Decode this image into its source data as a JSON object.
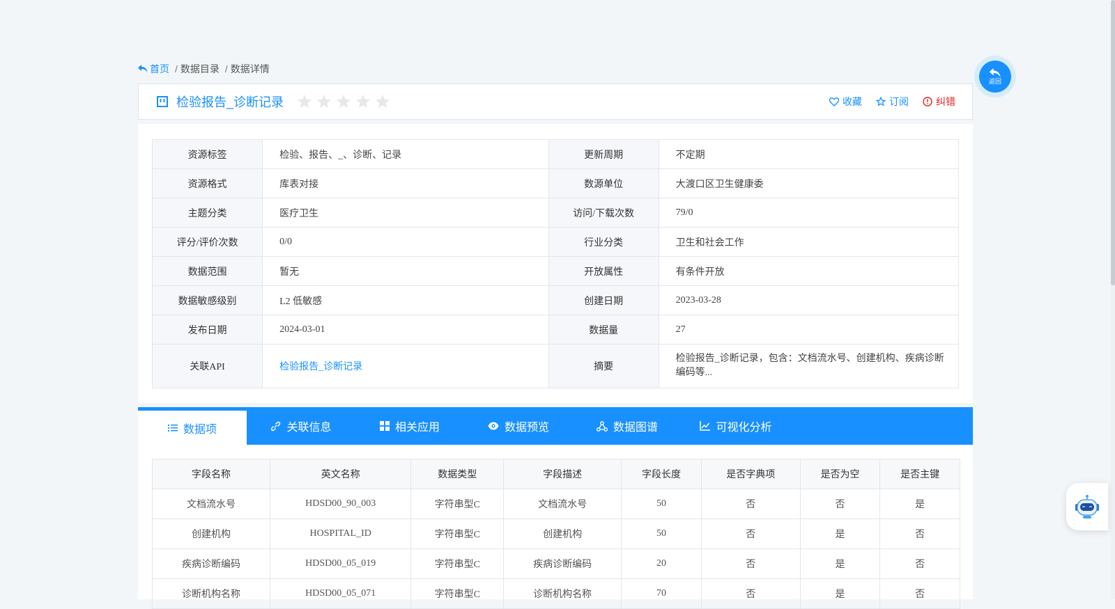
{
  "breadcrumb": {
    "home": "首页",
    "items": [
      "数据目录",
      "数据详情"
    ]
  },
  "title": {
    "text": "检验报告_诊断记录",
    "rating_stars": 0,
    "rating_max": 5,
    "actions": {
      "favorite": "收藏",
      "subscribe": "订阅",
      "report_error": "纠错"
    }
  },
  "info": [
    {
      "l1": "资源标签",
      "v1": "检验、报告、_、诊断、记录",
      "l2": "更新周期",
      "v2": "不定期"
    },
    {
      "l1": "资源格式",
      "v1": "库表对接",
      "l2": "数源单位",
      "v2": "大渡口区卫生健康委"
    },
    {
      "l1": "主题分类",
      "v1": "医疗卫生",
      "l2": "访问/下载次数",
      "v2": "79/0"
    },
    {
      "l1": "评分/评价次数",
      "v1": "0/0",
      "l2": "行业分类",
      "v2": "卫生和社会工作"
    },
    {
      "l1": "数据范围",
      "v1": "暂无",
      "l2": "开放属性",
      "v2": "有条件开放"
    },
    {
      "l1": "数据敏感级别",
      "v1": "L2 低敏感",
      "l2": "创建日期",
      "v2": "2023-03-28"
    },
    {
      "l1": "发布日期",
      "v1": "2024-03-01",
      "l2": "数据量",
      "v2": "27"
    },
    {
      "l1": "关联API",
      "v1": "检验报告_诊断记录",
      "l2": "摘要",
      "v2": "检验报告_诊断记录，包含：文档流水号、创建机构、疾病诊断编码等..."
    }
  ],
  "tabs": [
    {
      "label": "数据项",
      "icon": "list-icon"
    },
    {
      "label": "关联信息",
      "icon": "link-icon"
    },
    {
      "label": "相关应用",
      "icon": "grid-icon"
    },
    {
      "label": "数据预览",
      "icon": "eye-icon"
    },
    {
      "label": "数据图谱",
      "icon": "graph-icon"
    },
    {
      "label": "可视化分析",
      "icon": "line-chart-icon"
    }
  ],
  "fields": {
    "headers": [
      "字段名称",
      "英文名称",
      "数据类型",
      "字段描述",
      "字段长度",
      "是否字典项",
      "是否为空",
      "是否主键"
    ],
    "rows": [
      [
        "文档流水号",
        "HDSD00_90_003",
        "字符串型C",
        "文档流水号",
        "50",
        "否",
        "否",
        "是"
      ],
      [
        "创建机构",
        "HOSPITAL_ID",
        "字符串型C",
        "创建机构",
        "50",
        "否",
        "是",
        "否"
      ],
      [
        "疾病诊断编码",
        "HDSD00_05_019",
        "字符串型C",
        "疾病诊断编码",
        "20",
        "否",
        "是",
        "否"
      ],
      [
        "诊断机构名称",
        "HDSD00_05_071",
        "字符串型C",
        "诊断机构名称",
        "70",
        "否",
        "是",
        "否"
      ]
    ]
  },
  "back_button": {
    "label": "返回"
  },
  "colors": {
    "primary": "#1890ff",
    "error": "#e02424",
    "background": "#f3f6f9"
  }
}
